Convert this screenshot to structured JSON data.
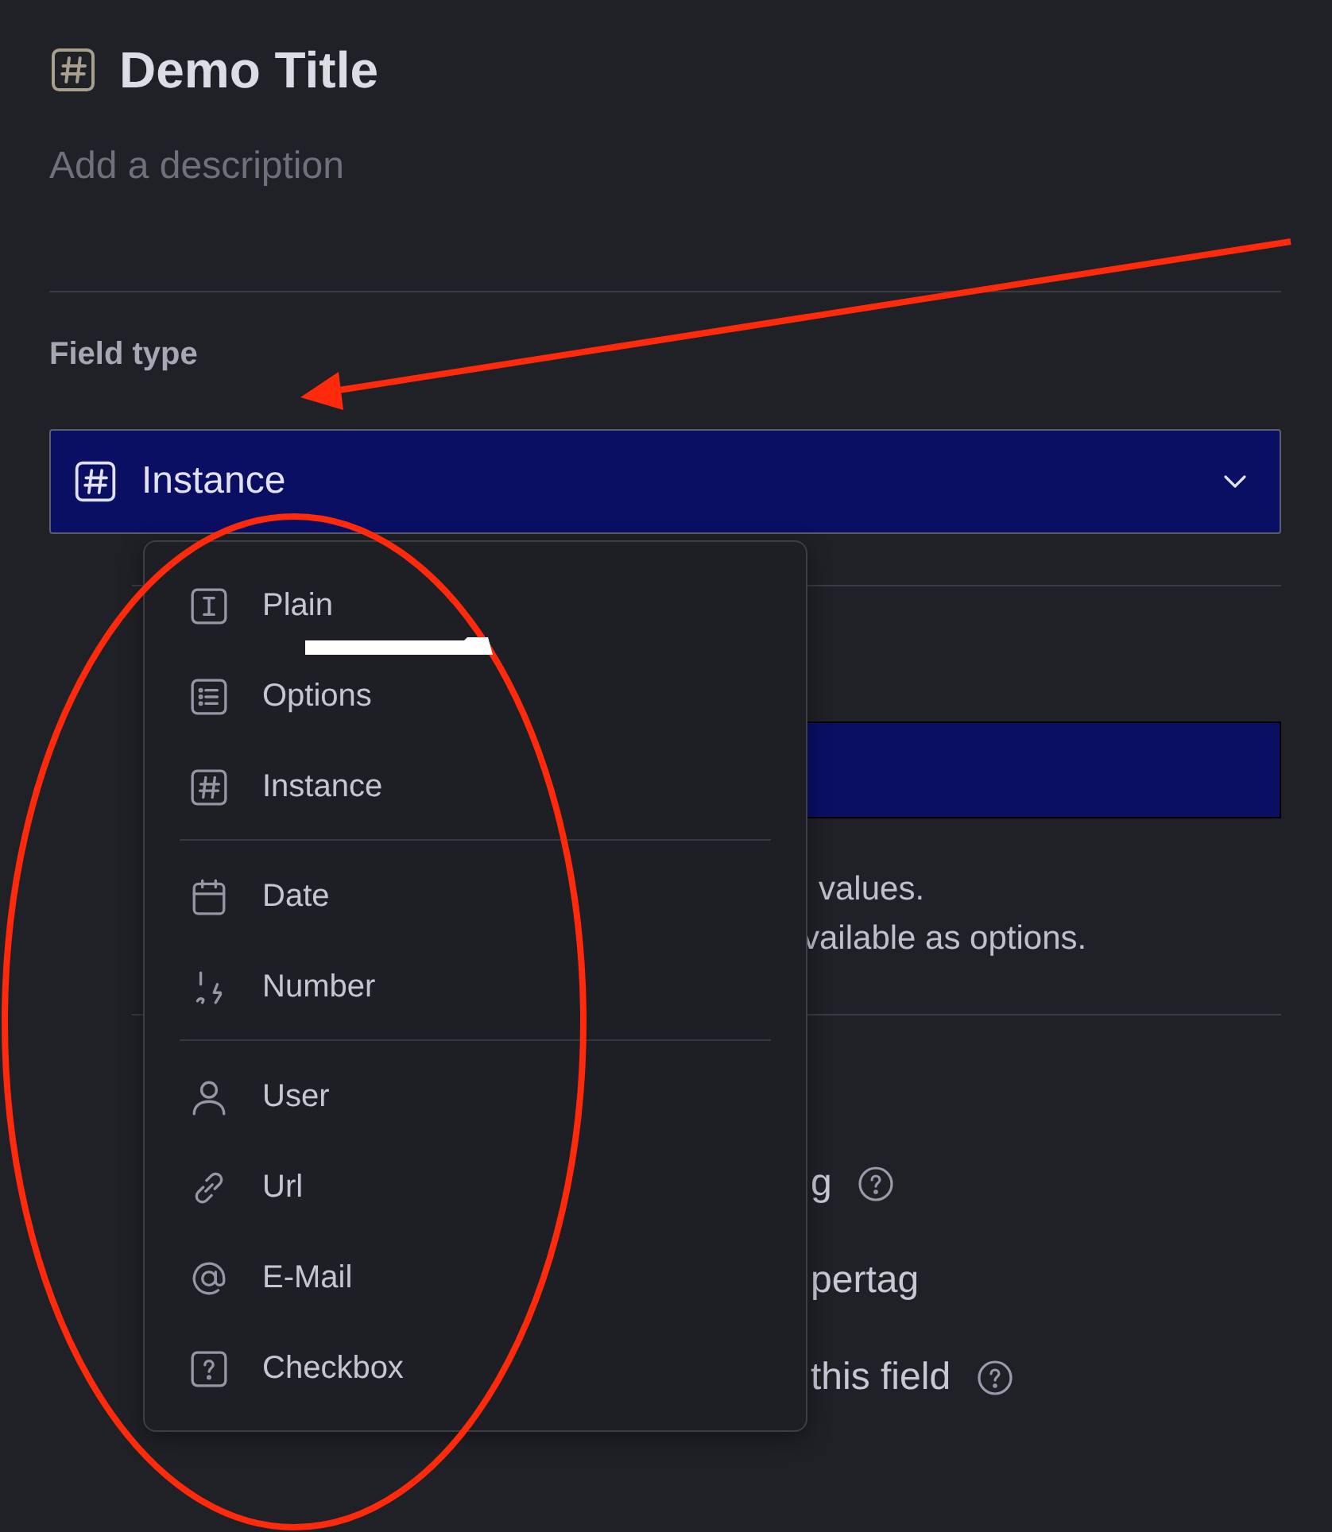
{
  "header": {
    "title": "Demo Title",
    "description_placeholder": "Add a description"
  },
  "field_type": {
    "label": "Field type",
    "value": "Instance",
    "kind": "instance"
  },
  "covered_section": {
    "help_lines": [
      "values.",
      "vailable as options."
    ],
    "options": [
      {
        "end": "g",
        "help": true
      },
      {
        "end": "pertag",
        "help": false
      },
      {
        "end": "this field",
        "help": true
      }
    ]
  },
  "menu": {
    "groups": [
      [
        {
          "label": "Plain",
          "kind": "plain"
        },
        {
          "label": "Options",
          "kind": "options"
        },
        {
          "label": "Instance",
          "kind": "instance"
        }
      ],
      [
        {
          "label": "Date",
          "kind": "date"
        },
        {
          "label": "Number",
          "kind": "number"
        }
      ],
      [
        {
          "label": "User",
          "kind": "user"
        },
        {
          "label": "Url",
          "kind": "url"
        },
        {
          "label": "E-Mail",
          "kind": "email"
        },
        {
          "label": "Checkbox",
          "kind": "checkbox"
        }
      ]
    ]
  }
}
